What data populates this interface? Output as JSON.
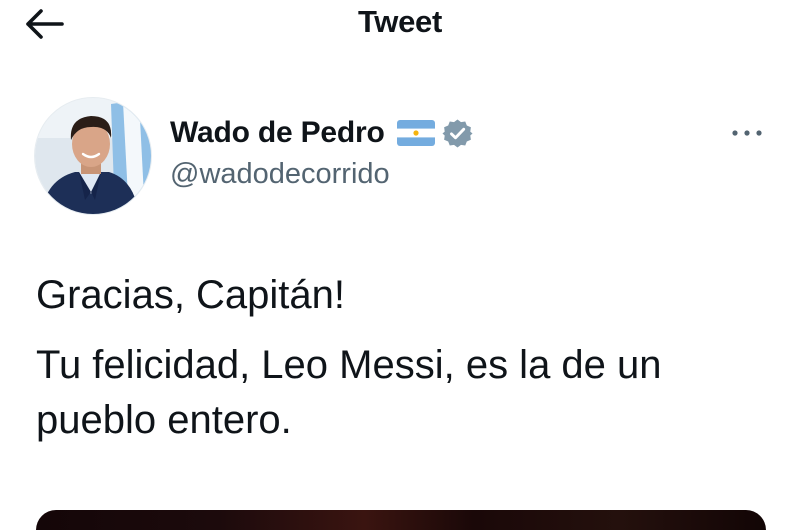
{
  "header": {
    "title": "Tweet",
    "back_icon": "arrow-left-icon"
  },
  "author": {
    "name": "Wado de Pedro",
    "handle": "@wadodecorrido",
    "flag_icon": "argentina-flag-icon",
    "verified_icon": "verified-badge-icon",
    "more_icon": "more-dots-icon"
  },
  "tweet": {
    "paragraphs": [
      "Gracias, Capitán!",
      "Tu felicidad, Leo Messi, es la de un pueblo entero."
    ]
  },
  "colors": {
    "text": "#0f1419",
    "secondary": "#536471",
    "verified": "#829aab",
    "flag_blue": "#74acdf",
    "flag_sun": "#f6b40e"
  }
}
